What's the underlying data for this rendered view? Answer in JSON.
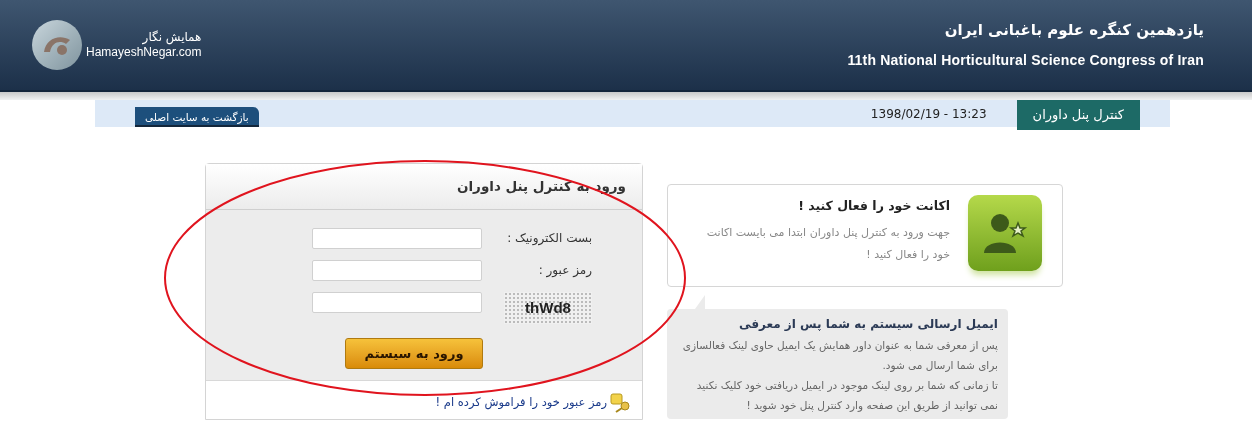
{
  "header": {
    "title_fa": "یازدهمین کنگره علوم باغبانی ایران",
    "title_en": "11th National Horticultural Science Congress of Iran",
    "logo_name": "همایش نگار",
    "logo_site": "HamayeshNegar.com"
  },
  "nav": {
    "tabs": [
      {
        "label": "کنترل پنل داوران",
        "selected": true
      }
    ],
    "datetime": "1398/02/19 - 13:23",
    "back_link": "بازگشت به سایت اصلی"
  },
  "login": {
    "title": "ورود به کنترل پنل داوران",
    "fields": [
      {
        "kind": "text",
        "label": "بست الکترونیک :"
      },
      {
        "kind": "password",
        "label": "رمز عبور :"
      },
      {
        "kind": "captcha",
        "captcha": "thWd8"
      }
    ],
    "submit": "ورود به سیستم",
    "forgot": "رمز عبور خود را فراموش کرده ام !"
  },
  "activate": {
    "title": "اکانت خود را فعال کنید !",
    "text": "جهت ورود به کنترل پنل داوران  ابتدا می بایست اکانت خود را فعال کنید !"
  },
  "email_note": {
    "title": "ایمیل ارسالی سیستم به شما پس از معرفی",
    "paragraphs": [
      "پس از  معرفی شما به عنوان داور همایش  یک ایمیل حاوی لینک فعالسازی برای شما ارسال می شود.",
      "تا زمانی که شما بر روی لینک موجود در ایمیل دریافتی خود کلیک نکنید نمی توانید از طریق این صفحه وارد کنترل پنل خود شوید !"
    ]
  }
}
